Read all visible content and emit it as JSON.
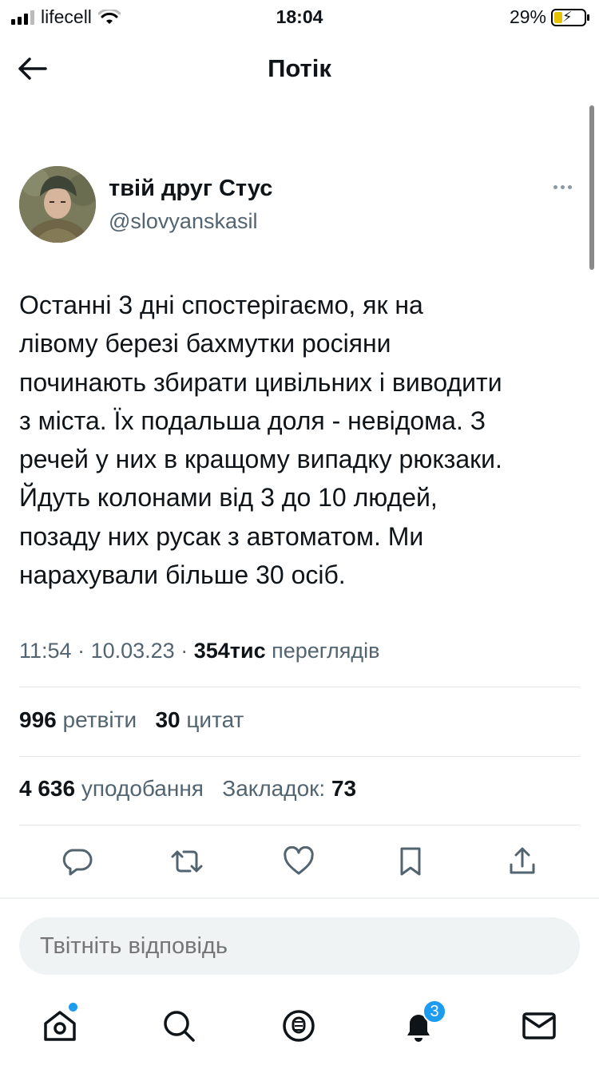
{
  "status_bar": {
    "carrier": "lifecell",
    "time": "18:04",
    "battery": "29%",
    "battery_level": 0.29
  },
  "header": {
    "title": "Потік"
  },
  "tweet": {
    "author_name": "твій друг Стус",
    "author_handle": "@slovyanskasil",
    "text": "Останні 3 дні спостерігаємо, як на\nлівому березі бахмутки росіяни\nпочинають збирати цивільних і виводити\nз міста. Їх подальша доля - невідома. З\nречей у них в кращому випадку рюкзаки.\nЙдуть колонами від 3 до 10 людей,\nпозаду них русак з автоматом. Ми\nнарахували більше 30 осіб.",
    "time": "11:54",
    "date": "10.03.23",
    "views_count": "354тис",
    "views_label": "переглядів",
    "retweets_count": "996",
    "retweets_label": "ретвіти",
    "quotes_count": "30",
    "quotes_label": "цитат",
    "likes_count": "4 636",
    "likes_label": "уподобання",
    "bookmarks_label": "Закладок:",
    "bookmarks_count": "73"
  },
  "reply": {
    "placeholder": "Твітніть відповідь"
  },
  "tabbar": {
    "notifications_badge": "3",
    "items": [
      "home-icon",
      "search-icon",
      "spaces-icon",
      "notifications-icon",
      "messages-icon"
    ]
  },
  "colors": {
    "text": "#0f1419",
    "secondary": "#536471",
    "accent": "#1d9bf0"
  }
}
